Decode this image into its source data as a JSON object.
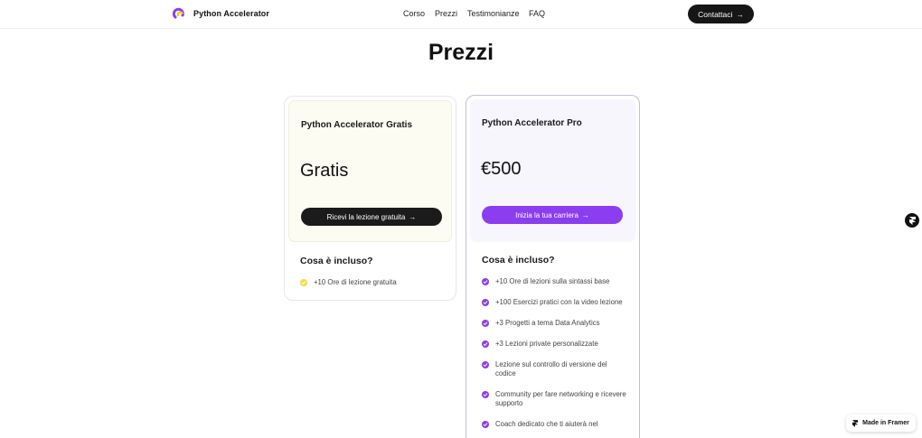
{
  "nav": {
    "brand": "Python Accelerator",
    "links": [
      "Corso",
      "Prezzi",
      "Testimonianze",
      "FAQ"
    ],
    "cta_label": "Contattaci",
    "cta_icon": "arrow-right-icon"
  },
  "page": {
    "title": "Prezzi"
  },
  "plans": [
    {
      "name": "Python Accelerator Gratis",
      "price": "Gratis",
      "cta_label": "Ricevi la lezione gratuita",
      "included_title": "Cosa è incluso?",
      "features": [
        "+10 Ore di lezione gratuita"
      ],
      "check_color": "#f6dc3f"
    },
    {
      "name": "Python Accelerator Pro",
      "price": "€500",
      "cta_label": "Inizia la tua carriera",
      "included_title": "Cosa è incluso?",
      "features": [
        "+10 Ore di lezioni sulla sintassi base",
        "+100 Esercizi pratici con la video lezione",
        "+3 Progetti a tema Data Analytics",
        "+3 Lezioni private personalizzate",
        "Lezione sul controllo di versione del codice",
        "Community per fare networking e ricevere supporto",
        "Coach dedicato che ti aiuterà nel"
      ],
      "check_color": "#8b3df0"
    }
  ],
  "framer_badge": {
    "label": "Made in Framer",
    "icon": "framer-icon"
  },
  "colors": {
    "accent": "#8b3df0",
    "dark": "#161616",
    "free_check": "#f6dc3f"
  }
}
